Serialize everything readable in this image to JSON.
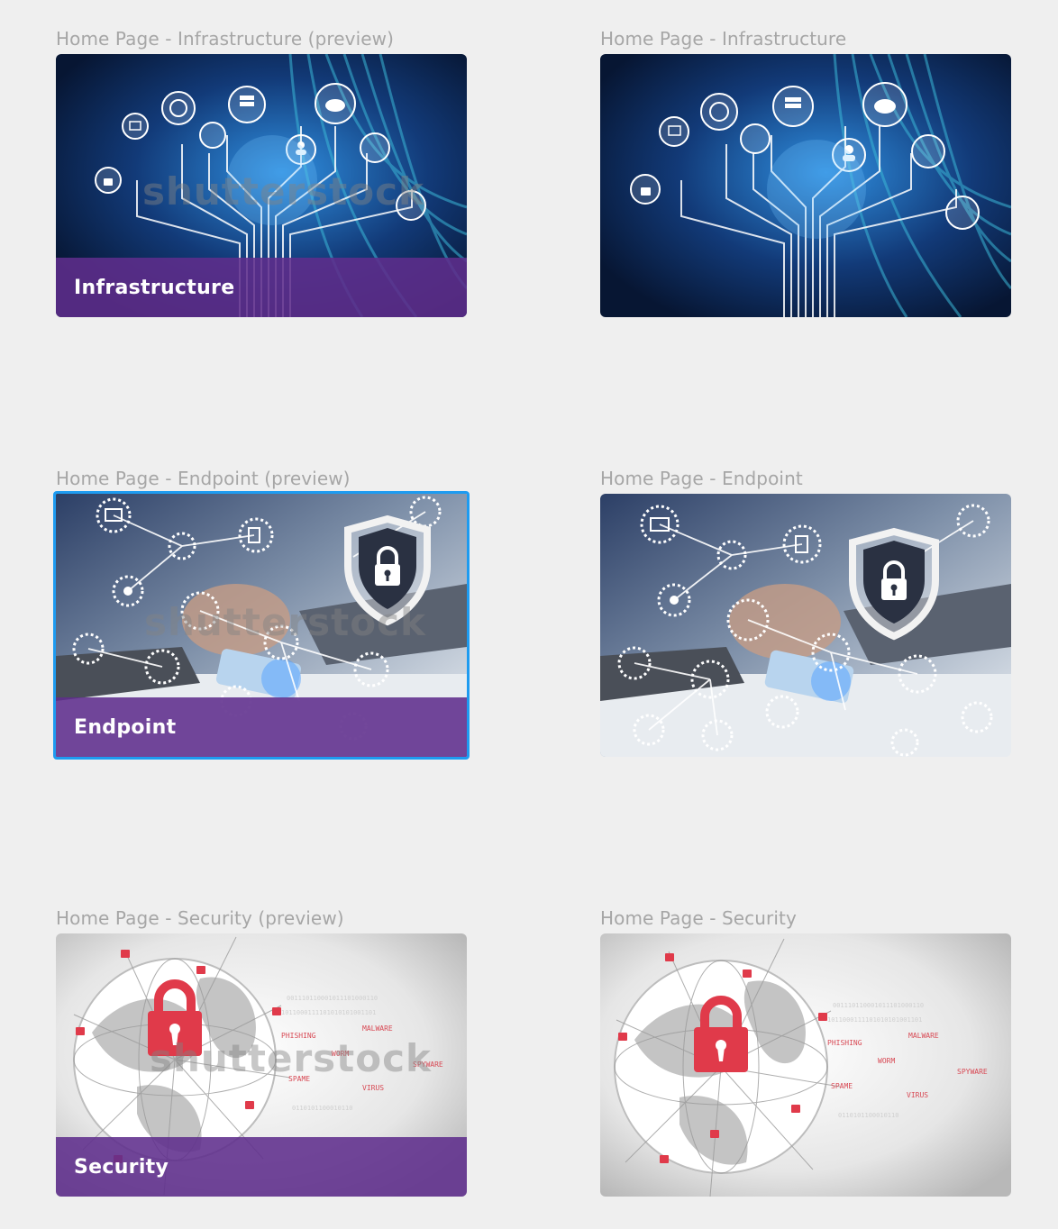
{
  "frames": [
    {
      "label": "Home Page - Infrastructure (preview)",
      "banner": "Infrastructure",
      "watermark": "shutterstock",
      "theme": "infrastructure"
    },
    {
      "label": "Home Page - Infrastructure",
      "theme": "infrastructure"
    },
    {
      "label": "Home Page - Endpoint (preview)",
      "banner": "Endpoint",
      "watermark": "shutterstock",
      "theme": "endpoint",
      "selected": true
    },
    {
      "label": "Home Page - Endpoint",
      "theme": "endpoint"
    },
    {
      "label": "Home Page - Security (preview)",
      "banner": "Security",
      "watermark": "shutterstock",
      "theme": "security"
    },
    {
      "label": "Home Page - Security",
      "theme": "security"
    }
  ],
  "security_terms": [
    "PHISHING",
    "MALWARE",
    "WORM",
    "SPYWARE",
    "SPAME",
    "VIRUS"
  ],
  "colors": {
    "banner": "#5f2d8c",
    "selection": "#1e9bf0",
    "label": "#a6a6a6",
    "lock_red": "#e03a4a"
  }
}
